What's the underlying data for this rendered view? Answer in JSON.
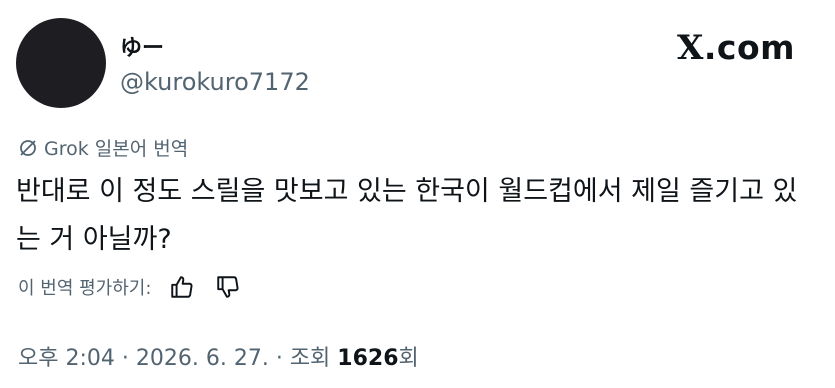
{
  "author": {
    "display_name": "ゆー",
    "handle": "@kurokuro7172"
  },
  "brand": {
    "x_mark": "X",
    "domain": ".com"
  },
  "translation": {
    "provider_label": "Grok 일본어 번역",
    "icon": "grok-icon"
  },
  "tweet": {
    "text": "반대로 이 정도 스릴을 맛보고 있는 한국이 월드컵에서 제일 즐기고 있는 거 아닐까?"
  },
  "rating": {
    "label": "이 번역 평가하기:",
    "like_icon": "thumbs-up-icon",
    "dislike_icon": "thumbs-down-icon"
  },
  "meta": {
    "time": "오후 2:04",
    "separator": " · ",
    "date": "2026. 6. 27.",
    "views_prefix": "조회 ",
    "views_count": "1626",
    "views_suffix": "회"
  }
}
